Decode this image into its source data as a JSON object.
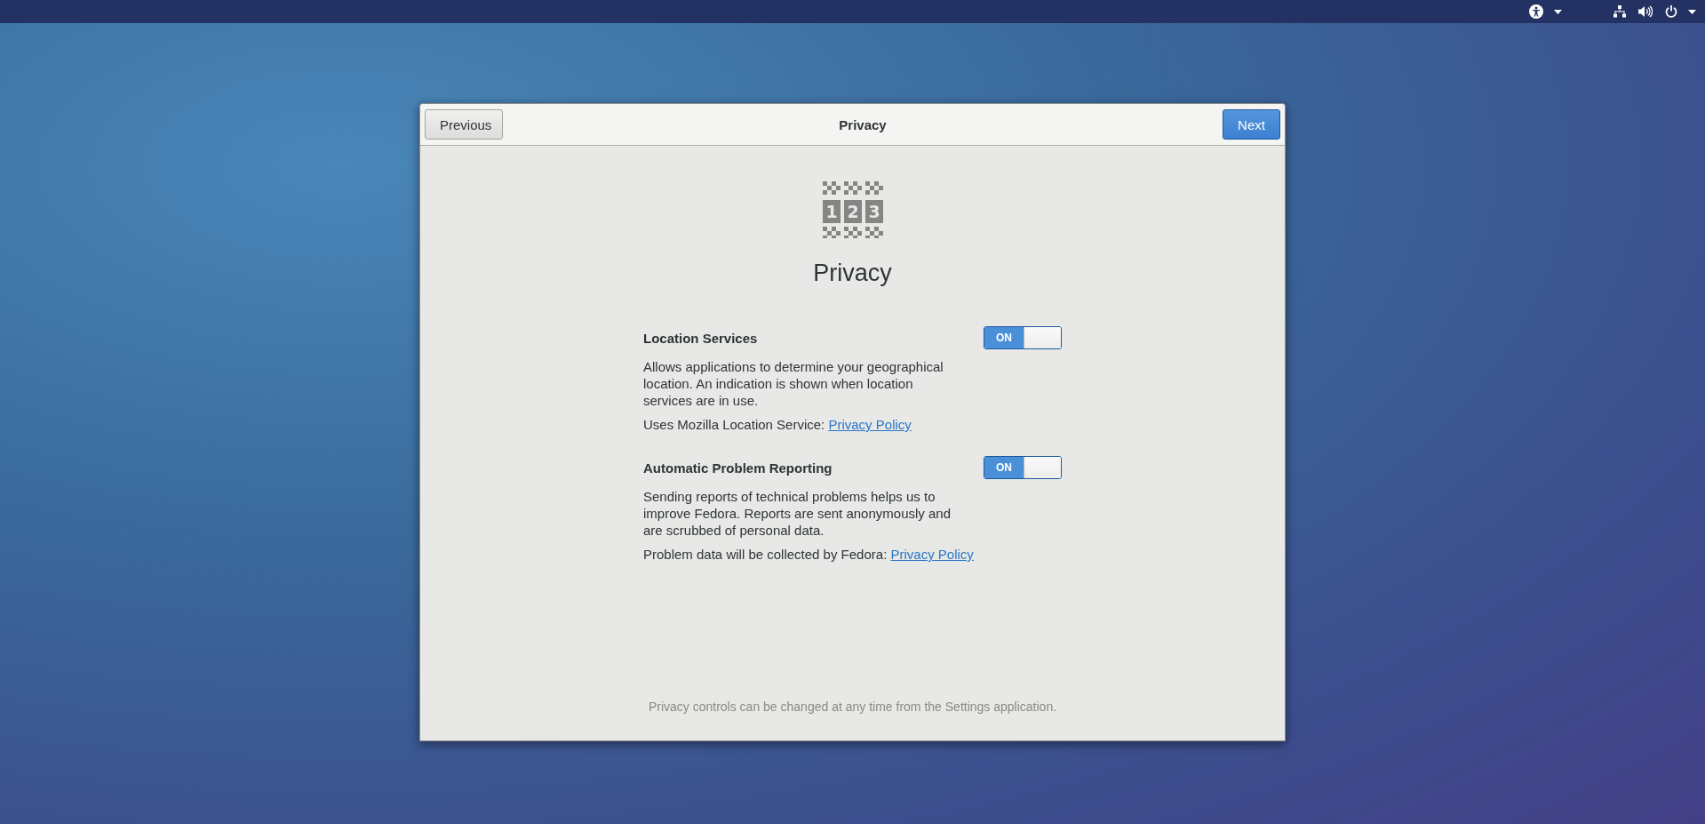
{
  "dialog": {
    "title": "Privacy",
    "previous_button": "Previous",
    "next_button": "Next",
    "logo_digits": [
      "1",
      "2",
      "3"
    ],
    "heading": "Privacy",
    "settings": [
      {
        "title": "Location Services",
        "on": true,
        "toggle_label": "ON",
        "description": "Allows applications to determine your geographical location. An indication is shown when location services are in use.",
        "source_text": "Uses Mozilla Location Service:",
        "link": "Privacy Policy"
      },
      {
        "title": "Automatic Problem Reporting",
        "on": true,
        "toggle_label": "ON",
        "description": "Sending reports of technical problems helps us to improve Fedora. Reports are sent anonymously and are scrubbed of personal data.",
        "source_text": "Problem data will be collected by Fedora:",
        "link": "Privacy Policy"
      }
    ],
    "footer": "Privacy controls can be changed at any time from the Settings application."
  }
}
